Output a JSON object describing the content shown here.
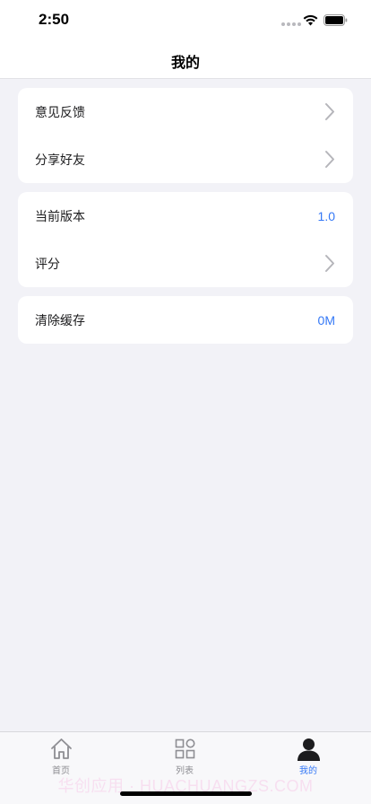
{
  "status_bar": {
    "time": "2:50"
  },
  "nav": {
    "title": "我的"
  },
  "groups": [
    {
      "rows": [
        {
          "label": "意见反馈",
          "accessory": "chevron-icon"
        },
        {
          "label": "分享好友",
          "accessory": "chevron-icon"
        }
      ]
    },
    {
      "rows": [
        {
          "label": "当前版本",
          "value": "1.0"
        },
        {
          "label": "评分",
          "accessory": "chevron-icon"
        }
      ]
    },
    {
      "rows": [
        {
          "label": "清除缓存",
          "value": "0M"
        }
      ]
    }
  ],
  "tabs": [
    {
      "label": "首页",
      "icon": "home-icon",
      "selected": false
    },
    {
      "label": "列表",
      "icon": "grid-icon",
      "selected": false
    },
    {
      "label": "我的",
      "icon": "person-icon",
      "selected": true
    }
  ],
  "watermark": "华创应用 · HUACHUANGZS.COM",
  "colors": {
    "accent": "#3478f6",
    "background": "#f2f2f7",
    "card": "#ffffff",
    "muted": "#8e8e93"
  }
}
